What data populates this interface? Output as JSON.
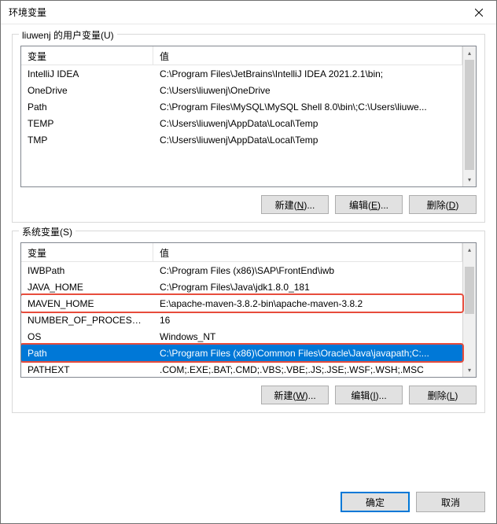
{
  "window": {
    "title": "环境变量"
  },
  "userVars": {
    "groupLabel": "liuwenj 的用户变量(U)",
    "headers": {
      "var": "变量",
      "val": "值"
    },
    "rows": [
      {
        "var": "IntelliJ IDEA",
        "val": "C:\\Program Files\\JetBrains\\IntelliJ IDEA 2021.2.1\\bin;"
      },
      {
        "var": "OneDrive",
        "val": "C:\\Users\\liuwenj\\OneDrive"
      },
      {
        "var": "Path",
        "val": "C:\\Program Files\\MySQL\\MySQL Shell 8.0\\bin\\;C:\\Users\\liuwe..."
      },
      {
        "var": "TEMP",
        "val": "C:\\Users\\liuwenj\\AppData\\Local\\Temp"
      },
      {
        "var": "TMP",
        "val": "C:\\Users\\liuwenj\\AppData\\Local\\Temp"
      }
    ],
    "buttons": {
      "new": "新建(N)...",
      "edit": "编辑(E)...",
      "delete": "删除(D)"
    }
  },
  "sysVars": {
    "groupLabel": "系统变量(S)",
    "headers": {
      "var": "变量",
      "val": "值"
    },
    "rows": [
      {
        "var": "IWBPath",
        "val": "C:\\Program Files (x86)\\SAP\\FrontEnd\\iwb"
      },
      {
        "var": "JAVA_HOME",
        "val": "C:\\Program Files\\Java\\jdk1.8.0_181"
      },
      {
        "var": "MAVEN_HOME",
        "val": "E:\\apache-maven-3.8.2-bin\\apache-maven-3.8.2"
      },
      {
        "var": "NUMBER_OF_PROCESSORS",
        "val": "16"
      },
      {
        "var": "OS",
        "val": "Windows_NT"
      },
      {
        "var": "Path",
        "val": "C:\\Program Files (x86)\\Common Files\\Oracle\\Java\\javapath;C:..."
      },
      {
        "var": "PATHEXT",
        "val": ".COM;.EXE;.BAT;.CMD;.VBS;.VBE;.JS;.JSE;.WSF;.WSH;.MSC"
      }
    ],
    "selectedIndex": 5,
    "buttons": {
      "new": "新建(W)...",
      "edit": "编辑(I)...",
      "delete": "删除(L)"
    }
  },
  "footer": {
    "ok": "确定",
    "cancel": "取消"
  }
}
